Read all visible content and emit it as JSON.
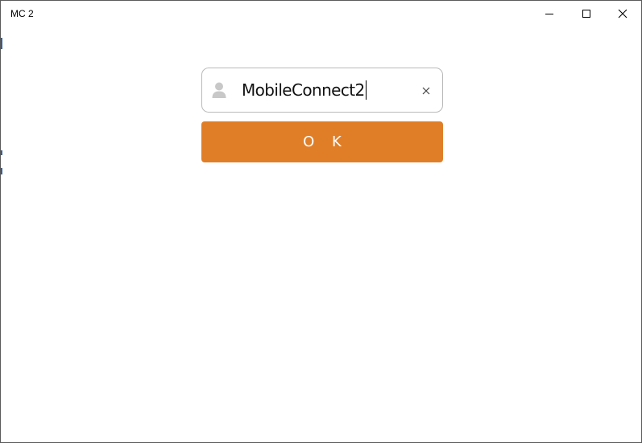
{
  "window": {
    "title": "MC 2",
    "controls": {
      "minimize": "minimize-icon",
      "maximize": "maximize-icon",
      "close": "close-icon"
    }
  },
  "login": {
    "username_value": "MobileConnect2",
    "user_icon": "user-icon",
    "clear_icon": "clear-icon",
    "ok_label": "O K"
  },
  "colors": {
    "accent": "#e07e27",
    "field_border": "#b9b9b9",
    "icon_gray": "#c8c8c8"
  }
}
